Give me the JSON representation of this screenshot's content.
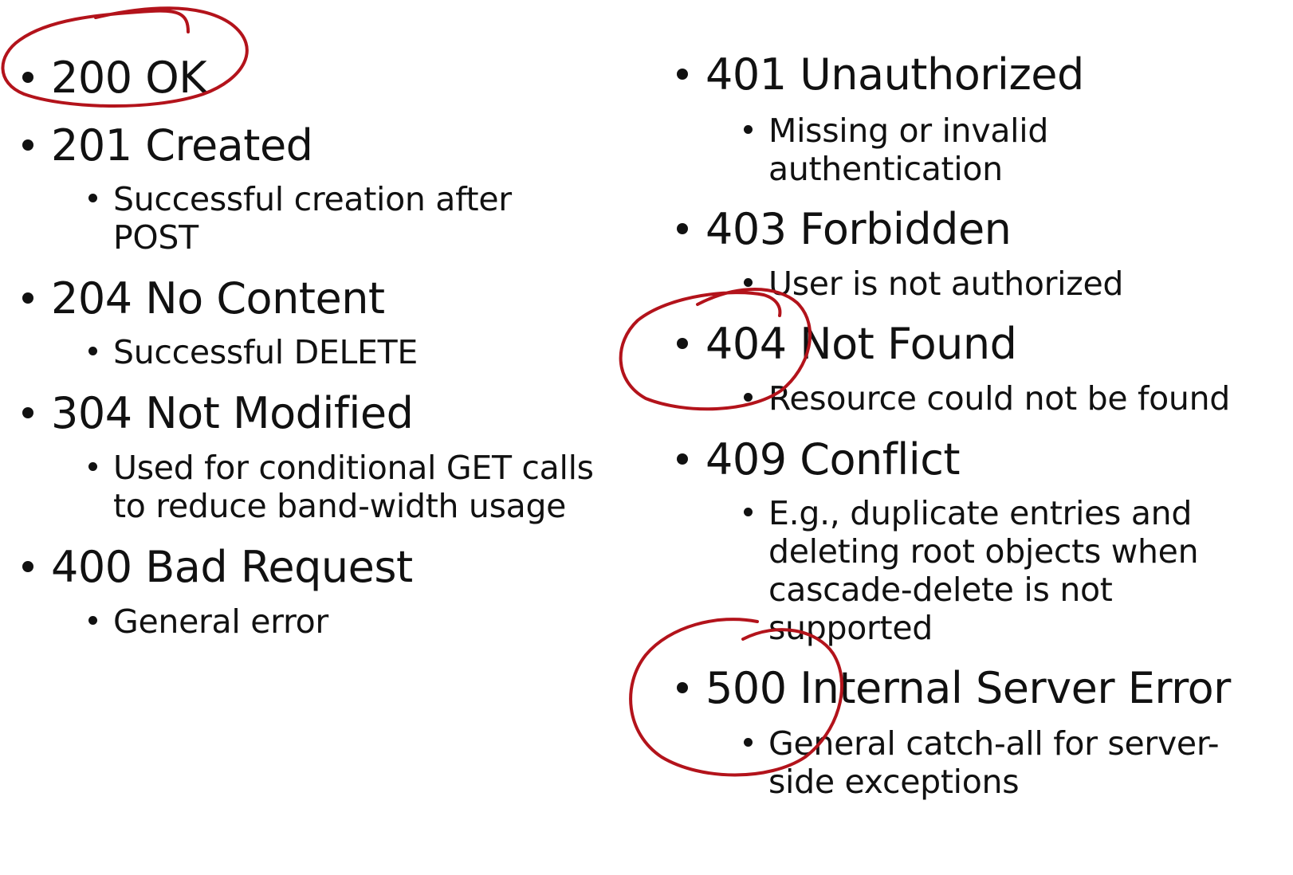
{
  "left_column": [
    {
      "code_text": "200 OK",
      "subs": []
    },
    {
      "code_text": "201 Created",
      "subs": [
        "Successful creation after\nPOST"
      ]
    },
    {
      "code_text": "204 No Content",
      "subs": [
        "Successful DELETE"
      ]
    },
    {
      "code_text": "304 Not Modified",
      "subs": [
        "Used for conditional GET calls\nto reduce band-width usage"
      ]
    },
    {
      "code_text": "400 Bad Request",
      "subs": [
        "General error"
      ]
    }
  ],
  "right_column": [
    {
      "code_text": "401 Unauthorized",
      "subs": [
        "Missing or invalid\nauthentication"
      ]
    },
    {
      "code_text": "403 Forbidden",
      "subs": [
        "User is not authorized"
      ]
    },
    {
      "code_text": "404 Not Found",
      "subs": [
        "Resource could not be found"
      ]
    },
    {
      "code_text": "409 Conflict",
      "subs": [
        "E.g., duplicate entries and\ndeleting root objects when\ncascade-delete is not\nsupported"
      ]
    },
    {
      "code_text": "500 Internal Server Error",
      "subs": [
        "General catch-all for server-\nside exceptions"
      ]
    }
  ],
  "annotations": {
    "ink_color": "#b3131b",
    "circled_items": [
      "200 OK",
      "404 Not Found",
      "500 Internal Server Error"
    ]
  }
}
